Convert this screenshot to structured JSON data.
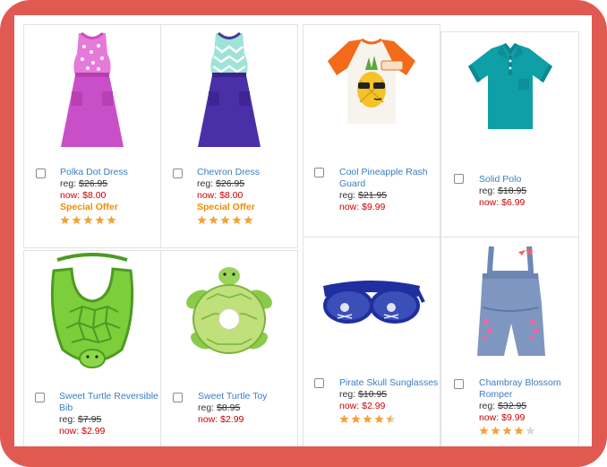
{
  "products": [
    {
      "name": "Polka Dot Dress",
      "reg_label": "reg:",
      "reg_price": "$26.95",
      "now_label": "now:",
      "now_price": "$8.00",
      "offer": "Special Offer",
      "rating": 5,
      "image": "pink-polka-dot-dress"
    },
    {
      "name": "Chevron Dress",
      "reg_label": "reg:",
      "reg_price": "$26.95",
      "now_label": "now:",
      "now_price": "$8.00",
      "offer": "Special Offer",
      "rating": 5,
      "image": "chevron-dress"
    },
    {
      "name": "Cool Pineapple Rash Guard",
      "reg_label": "reg:",
      "reg_price": "$21.95",
      "now_label": "now:",
      "now_price": "$9.99",
      "rating": 0,
      "image": "pineapple-rash-guard"
    },
    {
      "name": "Solid Polo",
      "reg_label": "reg:",
      "reg_price": "$18.95",
      "now_label": "now:",
      "now_price": "$6.99",
      "rating": 0,
      "image": "teal-polo-shirt"
    },
    {
      "name": "Sweet Turtle Reversible Bib",
      "reg_label": "reg:",
      "reg_price": "$7.95",
      "now_label": "now:",
      "now_price": "$2.99",
      "rating": 0,
      "image": "turtle-bib"
    },
    {
      "name": "Sweet Turtle Toy",
      "reg_label": "reg:",
      "reg_price": "$8.95",
      "now_label": "now:",
      "now_price": "$2.99",
      "rating": 0,
      "image": "turtle-toy"
    },
    {
      "name": "Pirate Skull Sunglasses",
      "reg_label": "reg:",
      "reg_price": "$10.95",
      "now_label": "now:",
      "now_price": "$2.99",
      "rating": 4.5,
      "image": "pirate-sunglasses"
    },
    {
      "name": "Chambray Blossom Romper",
      "reg_label": "reg:",
      "reg_price": "$32.95",
      "now_label": "now:",
      "now_price": "$9.99",
      "rating": 4,
      "image": "chambray-romper"
    }
  ],
  "colors": {
    "frame": "#e05a52",
    "link": "#3b7dc4",
    "sale": "#cc0000",
    "offer": "#f08c00",
    "star": "#f5a238",
    "star_empty": "#d8d8d8"
  }
}
